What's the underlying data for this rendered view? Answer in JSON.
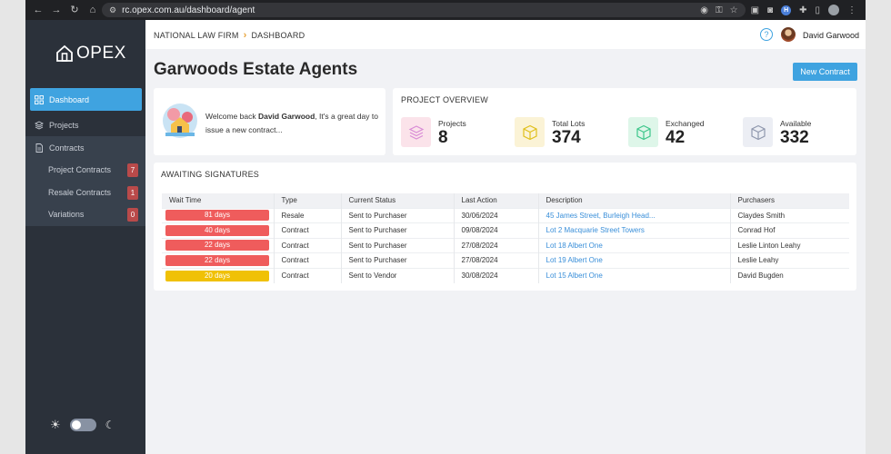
{
  "browser": {
    "url": "rc.opex.com.au/dashboard/agent",
    "ext_badge": "H"
  },
  "sidebar": {
    "logo": "OPEX",
    "items": [
      {
        "label": "Dashboard",
        "icon": "grid-icon",
        "active": true
      },
      {
        "label": "Projects",
        "icon": "layers-icon"
      },
      {
        "label": "Contracts",
        "icon": "document-icon"
      }
    ],
    "subitems": [
      {
        "label": "Project Contracts",
        "badge": "7"
      },
      {
        "label": "Resale Contracts",
        "badge": "1"
      },
      {
        "label": "Variations",
        "badge": "0"
      }
    ]
  },
  "header": {
    "breadcrumb": [
      "NATIONAL LAW FIRM",
      "DASHBOARD"
    ],
    "user_name": "David Garwood"
  },
  "page": {
    "title": "Garwoods Estate Agents",
    "new_contract_label": "New Contract"
  },
  "welcome": {
    "prefix": "Welcome back ",
    "name": "David Garwood",
    "suffix": ", It's a great day to issue a new contract..."
  },
  "overview": {
    "title": "PROJECT OVERVIEW",
    "stats": [
      {
        "label": "Projects",
        "value": "8",
        "icon": "layers-icon",
        "color": "#e28ad0"
      },
      {
        "label": "Total Lots",
        "value": "374",
        "icon": "cube-icon",
        "color": "#e0bf1a"
      },
      {
        "label": "Exchanged",
        "value": "42",
        "icon": "cube-icon",
        "color": "#3cc68a"
      },
      {
        "label": "Available",
        "value": "332",
        "icon": "cube-icon",
        "color": "#8f97ad"
      }
    ]
  },
  "signatures": {
    "title": "AWAITING SIGNATURES",
    "columns": [
      "Wait Time",
      "Type",
      "Current Status",
      "Last Action",
      "Description",
      "Purchasers"
    ],
    "rows": [
      {
        "wait": "81 days",
        "level": "red",
        "type": "Resale",
        "status": "Sent to Purchaser",
        "last_action": "30/06/2024",
        "description": "45 James Street, Burleigh Head...",
        "purchasers": "Claydes Smith"
      },
      {
        "wait": "40 days",
        "level": "red",
        "type": "Contract",
        "status": "Sent to Purchaser",
        "last_action": "09/08/2024",
        "description": "Lot 2 Macquarie Street Towers",
        "purchasers": "Conrad Hof"
      },
      {
        "wait": "22 days",
        "level": "red",
        "type": "Contract",
        "status": "Sent to Purchaser",
        "last_action": "27/08/2024",
        "description": "Lot 18 Albert One",
        "purchasers": "Leslie Linton Leahy"
      },
      {
        "wait": "22 days",
        "level": "red",
        "type": "Contract",
        "status": "Sent to Purchaser",
        "last_action": "27/08/2024",
        "description": "Lot 19 Albert One",
        "purchasers": "Leslie Leahy"
      },
      {
        "wait": "20 days",
        "level": "yellow",
        "type": "Contract",
        "status": "Sent to Vendor",
        "last_action": "30/08/2024",
        "description": "Lot 15 Albert One",
        "purchasers": "David Bugden"
      }
    ]
  },
  "colors": {
    "accent": "#3fa3e0",
    "sidebar_bg": "#2b313a",
    "badge_red": "#b94a4a",
    "wait_red": "#ef5c5c",
    "wait_yellow": "#f0c106",
    "link": "#3a8fd9"
  }
}
